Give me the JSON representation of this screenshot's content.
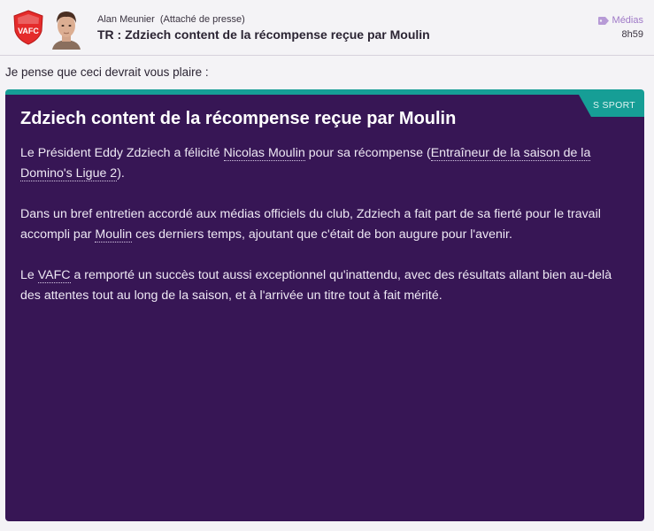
{
  "header": {
    "crest_text": "VAFC",
    "sender_name": "Alan Meunier",
    "sender_role": "(Attaché de presse)",
    "subject": "TR : Zdziech content de la récompense reçue par Moulin",
    "source": "Médias",
    "time": "8h59",
    "accent_color": "#9f79c7"
  },
  "intro": "Je pense que ceci devrait vous plaire :",
  "article": {
    "source_badge": "S SPORT",
    "title": "Zdziech content de la récompense reçue par Moulin",
    "p1": {
      "a": "Le Président Eddy Zdziech a félicité ",
      "link1": "Nicolas Moulin",
      "b": " pour sa récompense (",
      "link2": "Entraîneur de la saison de la Domino's Ligue 2",
      "c": ")."
    },
    "p2": {
      "a": "Dans un bref entretien accordé aux médias officiels du club, Zdziech a fait part de sa fierté pour le travail accompli par ",
      "link1": "Moulin",
      "b": " ces derniers temps, ajoutant que c'était de bon augure pour l'avenir."
    },
    "p3": {
      "a": "Le ",
      "link1": "VAFC",
      "b": " a remporté un succès tout aussi exceptionnel qu'inattendu, avec des résultats allant bien au-delà des attentes tout au long de la saison, et à l'arrivée un titre tout à fait mérité."
    },
    "card_color": "#371655",
    "ribbon_color": "#169e96"
  }
}
